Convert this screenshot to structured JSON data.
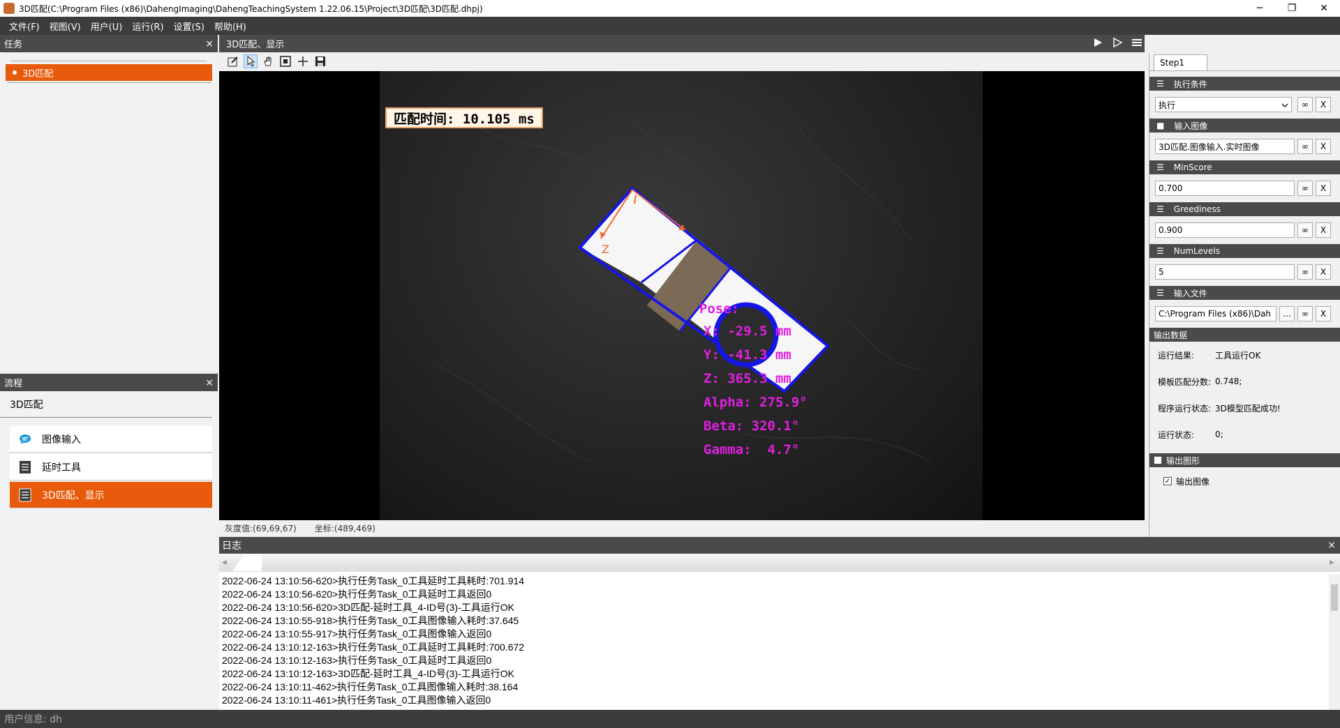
{
  "window": {
    "title": "3D匹配(C:\\Program Files (x86)\\DahengImaging\\DahengTeachingSystem 1.22.06.15\\Project\\3D匹配\\3D匹配.dhpj)",
    "minimize": "─",
    "maximize": "❐",
    "close": "✕"
  },
  "menu": [
    "文件(F)",
    "视图(V)",
    "用户(U)",
    "运行(R)",
    "设置(S)",
    "帮助(H)"
  ],
  "task_panel": {
    "title": "任务",
    "close": "×",
    "items": [
      "3D匹配"
    ]
  },
  "flow_panel": {
    "title": "流程",
    "close": "×",
    "flow_name": "3D匹配",
    "items": [
      {
        "label": "图像输入",
        "icon": "chat-bubble-icon",
        "active": false
      },
      {
        "label": "延时工具",
        "icon": "document-icon",
        "active": false
      },
      {
        "label": "3D匹配、显示",
        "icon": "document-icon",
        "active": true
      }
    ]
  },
  "document": {
    "tab_title": "3D匹配、显示",
    "run_icons": [
      "play-icon",
      "step-icon",
      "menu-icon"
    ],
    "tools": [
      "edit-icon",
      "pointer-icon",
      "hand-icon",
      "fit-icon",
      "crosshair-icon",
      "save-icon"
    ]
  },
  "viewer": {
    "timing": "匹配时间: 10.105 ms",
    "axis_label": "Z",
    "pose": {
      "title": "Pose:",
      "x": "X: -29.5 mm",
      "y": "Y: -41.3 mm",
      "z": "Z: 365.3 mm",
      "alpha": "Alpha: 275.9°",
      "beta": "Beta: 320.1°",
      "gamma": "Gamma:  4.7°"
    },
    "gray_value": "灰度值:(69,69,67)",
    "coordinates": "坐标:(489,469)"
  },
  "properties": {
    "tab": "Step1",
    "sections": [
      {
        "title": "执行条件",
        "icon": "☰",
        "value": "执行",
        "type": "dropdown"
      },
      {
        "title": "输入图像",
        "icon": "■",
        "value": "3D匹配.图像输入.实时图像",
        "type": "text"
      },
      {
        "title": "MinScore",
        "icon": "☰",
        "value": "0.700",
        "type": "text"
      },
      {
        "title": "Greediness",
        "icon": "☰",
        "value": "0.900",
        "type": "text"
      },
      {
        "title": "NumLevels",
        "icon": "☰",
        "value": "5",
        "type": "text"
      },
      {
        "title": "输入文件",
        "icon": "☰",
        "value": "C:\\Program Files (x86)\\Dah",
        "type": "file"
      }
    ],
    "link_btn": "∞",
    "clear_btn": "X",
    "browse_btn": "...",
    "output_title": "输出数据",
    "outputs": [
      {
        "label": "运行结果:",
        "value": "工具运行OK"
      },
      {
        "label": "模板匹配分数:",
        "value": "0.748;"
      },
      {
        "label": "程序运行状态:",
        "value": "3D模型匹配成功!"
      },
      {
        "label": "运行状态:",
        "value": "0;"
      }
    ],
    "output_graphics_title": "输出图形",
    "output_image_label": "输出图像",
    "check": "✓"
  },
  "log": {
    "title": "日志",
    "close": "×",
    "lines": [
      "2022-06-24 13:10:56-620>执行任务Task_0工具延时工具耗时:701.914",
      "2022-06-24 13:10:56-620>执行任务Task_0工具延时工具返回0",
      "2022-06-24 13:10:56-620>3D匹配-延时工具_4-ID号(3)-工具运行OK",
      "2022-06-24 13:10:55-918>执行任务Task_0工具图像输入耗时:37.645",
      "2022-06-24 13:10:55-917>执行任务Task_0工具图像输入返回0",
      "2022-06-24 13:10:12-163>执行任务Task_0工具延时工具耗时:700.672",
      "2022-06-24 13:10:12-163>执行任务Task_0工具延时工具返回0",
      "2022-06-24 13:10:12-163>3D匹配-延时工具_4-ID号(3)-工具运行OK",
      "2022-06-24 13:10:11-462>执行任务Task_0工具图像输入耗时:38.164",
      "2022-06-24 13:10:11-461>执行任务Task_0工具图像输入返回0"
    ]
  },
  "status": {
    "user_info": "用户信息:  dh"
  },
  "colors": {
    "accent": "#e85a0c",
    "panel_header": "#4a4a4a",
    "pose_text": "#e020e0",
    "contour": "#1515e8",
    "axis": "#f26a2a"
  }
}
